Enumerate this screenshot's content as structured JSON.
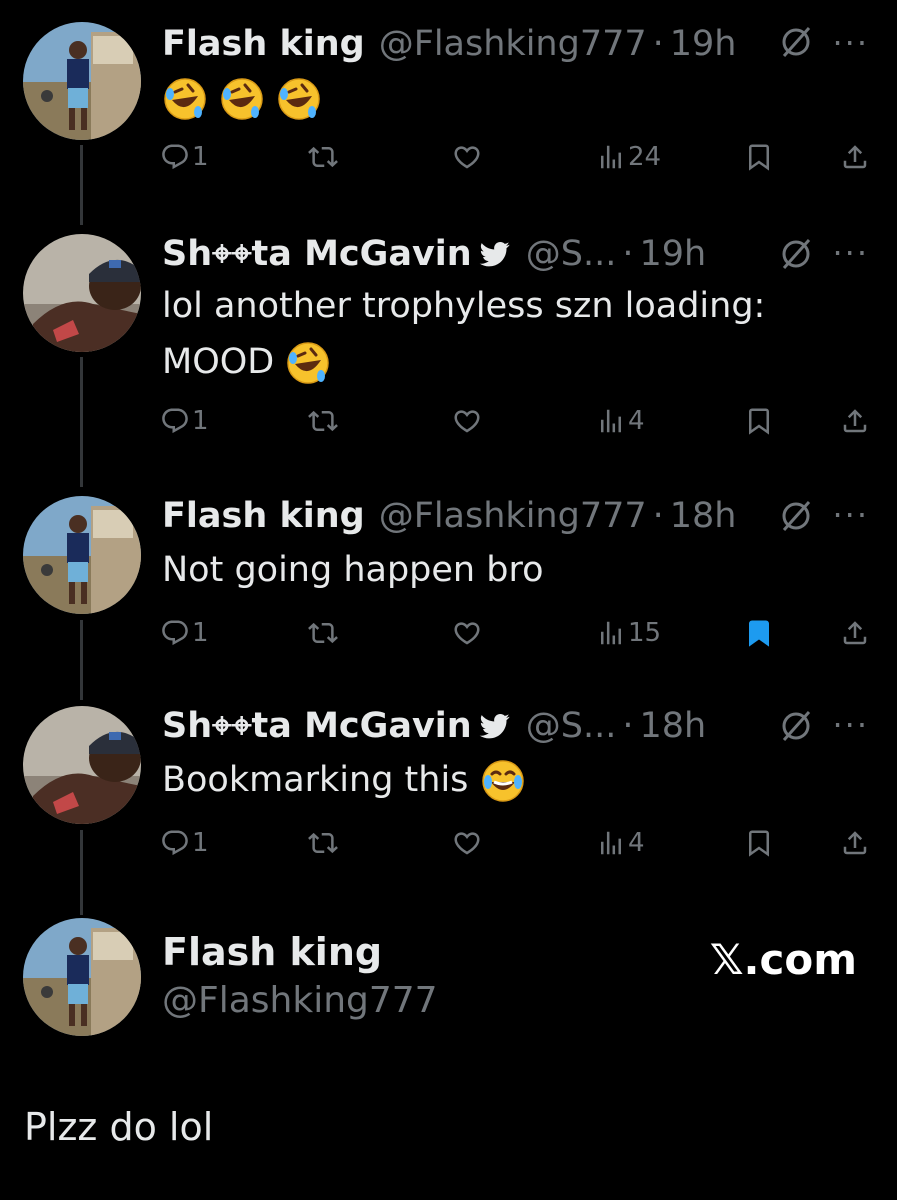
{
  "tweets": [
    {
      "name": "Flash king",
      "handle": "@Flashking777",
      "time": "19h",
      "text": "",
      "emojis": [
        "rofl",
        "rofl",
        "rofl"
      ],
      "replies": "1",
      "views": "24",
      "bookmarked": false,
      "verified": false
    },
    {
      "name": "Sh⌖⌖ta McGavin",
      "handle": "@S...",
      "time": "19h",
      "text_line1": "lol another trophyless szn loading:",
      "text_line2": "MOOD",
      "emojis": [
        "rofl"
      ],
      "replies": "1",
      "views": "4",
      "bookmarked": false,
      "verified": true
    },
    {
      "name": "Flash king",
      "handle": "@Flashking777",
      "time": "18h",
      "text": "Not going happen bro",
      "replies": "1",
      "views": "15",
      "bookmarked": true,
      "verified": false
    },
    {
      "name": "Sh⌖⌖ta McGavin",
      "handle": "@S...",
      "time": "18h",
      "text": "Bookmarking this",
      "emojis": [
        "joy"
      ],
      "replies": "1",
      "views": "4",
      "bookmarked": false,
      "verified": true
    }
  ],
  "reply": {
    "name": "Flash king",
    "handle": "@Flashking777",
    "text": "Plzz do lol"
  },
  "brand": "𝕏.com",
  "dot": "·",
  "more": "···",
  "colors": {
    "background": "#000000",
    "text": "#e7e9ea",
    "muted": "#71767b",
    "bookmark_active": "#1d9bf0"
  }
}
